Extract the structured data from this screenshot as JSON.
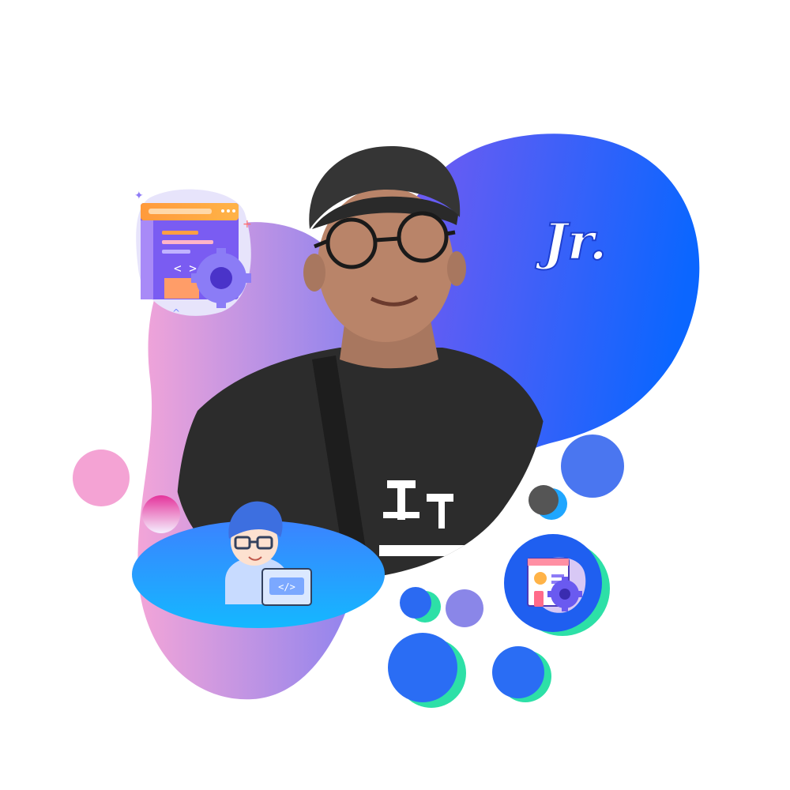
{
  "badge": {
    "text": "Jr."
  },
  "colors": {
    "blue_blob_start": "#7d5cf0",
    "blue_blob_end": "#0b66ff",
    "pink_blob_start": "#f3a7d7",
    "pink_blob_end": "#8f7ff0",
    "accent_green": "#2de0a7",
    "accent_blue": "#1f6bff",
    "ellipse_top": "#2d86ff",
    "ellipse_bottom": "#18b5ff",
    "shirt": "#2b2b2b",
    "cap": "#333333",
    "skin": "#b9856c"
  },
  "icons": [
    "code-window-icon",
    "developer-avatar-icon",
    "settings-dashboard-icon"
  ]
}
